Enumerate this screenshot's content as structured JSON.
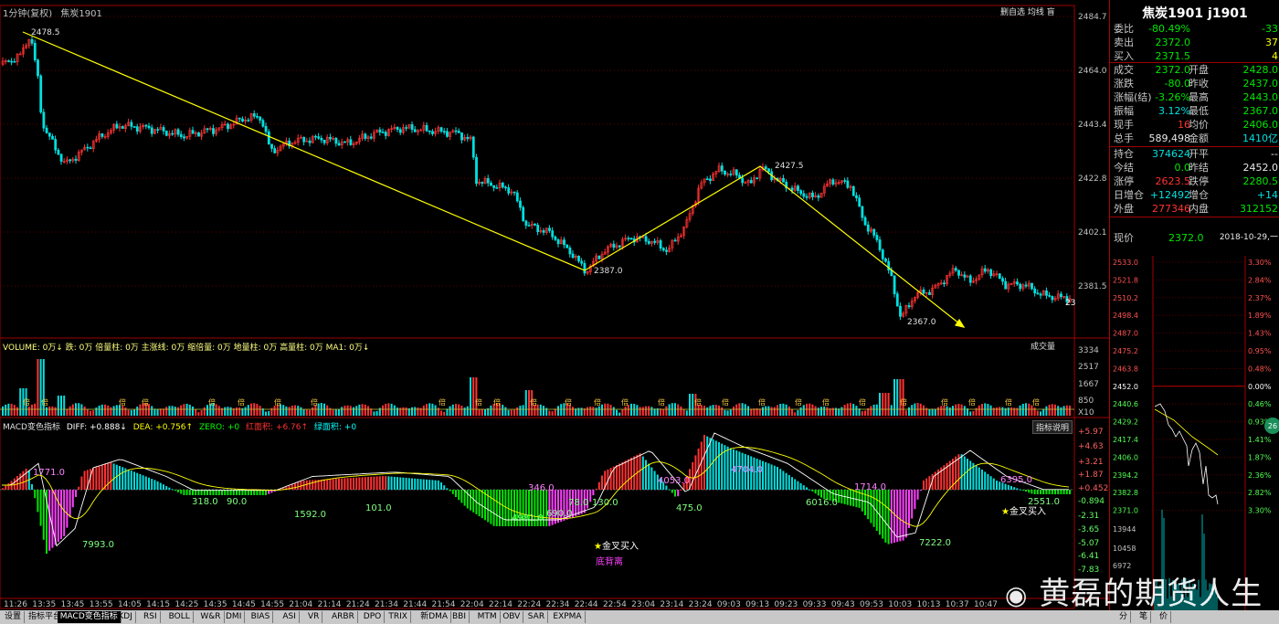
{
  "header": {
    "period": "1分钟(复权)",
    "symbol": "焦炭1901",
    "toolbar_right": "删自选 均线 盲"
  },
  "price_axis": [
    "2484.7",
    "2464.0",
    "2443.4",
    "2422.8",
    "2402.1",
    "2381.5"
  ],
  "price_last_partial": "23",
  "annotations": {
    "high1": "2478.5",
    "low1": "2387.0",
    "high2": "2427.5",
    "low2": "2367.0"
  },
  "volume_header": "VOLUME: 0万↓  跌: 0万  倍量柱: 0万  主涨线: 0万  缩倍量: 0万  地量柱: 0万  高量柱: 0万  MA1: 0万↓",
  "volume_right_label": "成交量",
  "volume_axis": [
    "3334",
    "2517",
    "1667",
    "850",
    "X10"
  ],
  "volume_tag": "倍",
  "macd_header": {
    "name": "MACD变色指标",
    "diff": "DIFF: +0.888↓",
    "dea": "DEA: +0.756↑",
    "zero": "ZERO: +0",
    "red_area": "红面积: +6.76↑",
    "green_area": "绿面积: +0"
  },
  "macd_right_label": "指标说明",
  "macd_axis": [
    "+5.97",
    "+4.63",
    "+3.21",
    "+1.87",
    "+0.452",
    "-0.894",
    "-2.31",
    "-3.65",
    "-5.07",
    "-6.41",
    "-7.83"
  ],
  "macd_labels": [
    "1771.0",
    "318.0",
    "90.0",
    "1592.0",
    "101.0",
    "7993.0",
    "4981.0",
    "690.0",
    "78.0",
    "130.0",
    "346.0",
    "4053.0",
    "4704.0",
    "475.0",
    "1714.0",
    "6016.0",
    "7222.0",
    "6395.0",
    "2551.0"
  ],
  "macd_signals": {
    "golden_cross": "金叉买入",
    "bottom_divergence": "底背离",
    "golden_cross2": "金叉买入"
  },
  "time_axis": [
    "11:26",
    "13:35",
    "13:45",
    "13:55",
    "14:05",
    "14:15",
    "14:25",
    "14:35",
    "14:45",
    "14:55",
    "21:04",
    "21:14",
    "21:24",
    "21:34",
    "21:44",
    "21:54",
    "22:04",
    "22:14",
    "22:24",
    "22:34",
    "22:44",
    "22:54",
    "23:04",
    "23:14",
    "23:24",
    "09:03",
    "09:13",
    "09:23",
    "09:33",
    "09:43",
    "09:53",
    "10:03",
    "10:13",
    "10:37",
    "10:47"
  ],
  "quote": {
    "title": "焦炭1901 j1901",
    "rows": [
      {
        "l": "委比",
        "v1": "-80.49%",
        "c1": "dn",
        "l2": "",
        "v2": "-33",
        "c2": "dn"
      },
      {
        "l": "卖出",
        "v1": "2372.0",
        "c1": "dn",
        "l2": "",
        "v2": "37",
        "c2": "yl"
      },
      {
        "l": "买入",
        "v1": "2371.5",
        "c1": "dn",
        "l2": "",
        "v2": "4",
        "c2": "yl"
      },
      {
        "l": "成交",
        "v1": "2372.0",
        "c1": "dn",
        "l2": "开盘",
        "v2": "2428.0",
        "c2": "dn"
      },
      {
        "l": "涨跌",
        "v1": "-80.0",
        "c1": "dn",
        "l2": "昨收",
        "v2": "2437.0",
        "c2": "dn"
      },
      {
        "l": "涨幅(结)",
        "v1": "-3.26%",
        "c1": "dn",
        "l2": "最高",
        "v2": "2443.0",
        "c2": "dn"
      },
      {
        "l": "振幅",
        "v1": "3.12%",
        "c1": "cy",
        "l2": "最低",
        "v2": "2367.0",
        "c2": "dn"
      },
      {
        "l": "现手",
        "v1": "16",
        "c1": "up",
        "l2": "均价",
        "v2": "2406.0",
        "c2": "dn"
      },
      {
        "l": "总手",
        "v1": "589,498",
        "c1": "wh",
        "l2": "金额",
        "v2": "1410亿",
        "c2": "cy"
      },
      {
        "l": "持仓",
        "v1": "374624",
        "c1": "cy",
        "l2": "开平",
        "v2": "--",
        "c2": "wh"
      },
      {
        "l": "今结",
        "v1": "0.0",
        "c1": "dn",
        "l2": "昨结",
        "v2": "2452.0",
        "c2": "wh"
      },
      {
        "l": "涨停",
        "v1": "2623.5",
        "c1": "up",
        "l2": "跌停",
        "v2": "2280.5",
        "c2": "dn"
      },
      {
        "l": "日增仓",
        "v1": "+12492",
        "c1": "cy",
        "l2": "增仓",
        "v2": "+14",
        "c2": "cy"
      },
      {
        "l": "外盘",
        "v1": "277346",
        "c1": "up",
        "l2": "内盘",
        "v2": "312152",
        "c2": "dn"
      }
    ],
    "now_label": "现价",
    "now_price": "2372.0",
    "date": "2018-10-29,一"
  },
  "mini_chart": {
    "left_axis": [
      "2533.0",
      "2521.8",
      "2510.2",
      "2498.4",
      "2487.0",
      "2475.2",
      "2463.8",
      "2452.0",
      "2440.6",
      "2429.2",
      "2417.4",
      "2406.0",
      "2394.2",
      "2382.8",
      "2371.0"
    ],
    "right_axis": [
      "3.30%",
      "2.84%",
      "2.37%",
      "1.89%",
      "1.43%",
      "0.95%",
      "0.48%",
      "0.00%",
      "0.46%",
      "0.93%",
      "1.41%",
      "1.87%",
      "2.36%",
      "2.82%",
      "3.30%"
    ],
    "vol_axis": [
      "13944",
      "10458",
      "6972"
    ],
    "badge": "26"
  },
  "bottom_tabs": [
    {
      "label": "设置",
      "active": false
    },
    {
      "label": "指标平台",
      "active": false
    },
    {
      "label": "MACD变色指标",
      "active": true
    },
    {
      "label": "KDJ",
      "active": false
    },
    {
      "label": "RSI",
      "active": false
    },
    {
      "label": "BOLL",
      "active": false
    },
    {
      "label": "W&R",
      "active": false
    },
    {
      "label": "DMI",
      "active": false
    },
    {
      "label": "BIAS",
      "active": false
    },
    {
      "label": "ASI",
      "active": false
    },
    {
      "label": "VR",
      "active": false
    },
    {
      "label": "ARBR",
      "active": false
    },
    {
      "label": "DPO",
      "active": false
    },
    {
      "label": "TRIX",
      "active": false
    },
    {
      "label": "新DMA",
      "active": false
    },
    {
      "label": "BBI",
      "active": false
    },
    {
      "label": "MTM",
      "active": false
    },
    {
      "label": "OBV",
      "active": false
    },
    {
      "label": "SAR",
      "active": false
    },
    {
      "label": "EXPMA",
      "active": false
    }
  ],
  "right_bottom_tabs": [
    "分",
    "笔",
    "价"
  ],
  "watermark": "黄磊的期货人生",
  "colors": {
    "up": "#ff3232",
    "down": "#00e0e0",
    "trend": "#ffff00",
    "grid": "#a00000"
  }
}
